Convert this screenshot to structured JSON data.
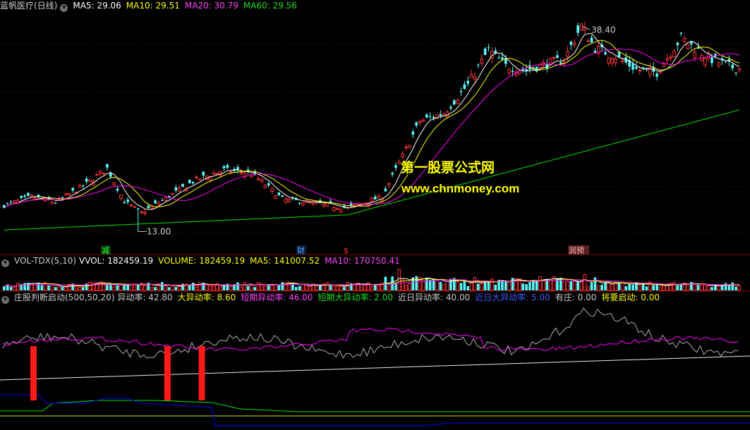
{
  "main_header": {
    "title": "蓝帆医疗(日线)",
    "ma5": "MA5: 29.06",
    "ma10": "MA10: 29.51",
    "ma20": "MA20: 30.79",
    "ma60": "MA60: 29.56"
  },
  "vol_header": {
    "name": "VOL-TDX(5,10)",
    "vvol": "VVOL: 182459.19",
    "volume": "VOLUME: 182459.19",
    "ma5": "MA5: 141007.52",
    "ma10": "MA10: 170750.41"
  },
  "ind_header": {
    "name": "庄股判断启动(500,50,20)",
    "v1": "异动率: 42.80",
    "v2": "大异动率: 8.60",
    "v3": "短期异动率: 46.00",
    "v4": "短期大异动率: 2.00",
    "v5": "近日异动率: 40.00",
    "v6": "近日大异动率: 5.00",
    "v7": "有庄: 0.00",
    "v8": "将要启动: 0.00"
  },
  "annotations": {
    "high": "38.40",
    "low": "13.00",
    "marker1": "减",
    "marker2": "财",
    "marker3": "$",
    "marker4": "润预"
  },
  "watermark": {
    "line1": "第一股票公式网",
    "line2": "www.chnmoney.com"
  },
  "colors": {
    "up": "#ff3232",
    "down": "#54fcfc",
    "ma5": "#ffffff",
    "ma10": "#ffff00",
    "ma20": "#ff00ff",
    "ma60": "#00e600",
    "bar_signal": "#ff1a1a",
    "blue_line": "#0000ff"
  },
  "chart_data": {
    "type": "candlestick",
    "price_anchors": [
      [
        0,
        16.2
      ],
      [
        8,
        17.3
      ],
      [
        15,
        16.6
      ],
      [
        24,
        18.9
      ],
      [
        30,
        20.8
      ],
      [
        35,
        16.7
      ],
      [
        40,
        15.3
      ],
      [
        47,
        17.1
      ],
      [
        56,
        19.4
      ],
      [
        64,
        20.6
      ],
      [
        72,
        20.2
      ],
      [
        81,
        17.0
      ],
      [
        90,
        16.5
      ],
      [
        100,
        15.9
      ],
      [
        110,
        17.3
      ],
      [
        116,
        22.3
      ],
      [
        121,
        26.6
      ],
      [
        128,
        27.6
      ],
      [
        135,
        31.1
      ],
      [
        141,
        35.4
      ],
      [
        146,
        33.4
      ],
      [
        152,
        32.9
      ],
      [
        158,
        33.7
      ],
      [
        163,
        34.2
      ],
      [
        168,
        38.4
      ],
      [
        172,
        35.6
      ],
      [
        178,
        34.6
      ],
      [
        184,
        33.0
      ],
      [
        190,
        32.6
      ],
      [
        197,
        36.9
      ],
      [
        205,
        34.4
      ],
      [
        213,
        33.1
      ]
    ],
    "high": {
      "index": 168,
      "value": 38.4
    },
    "low": {
      "index": 39,
      "value": 13.0
    },
    "ylim": [
      12,
      40
    ],
    "indicator_bars": [
      8,
      47,
      57
    ]
  }
}
